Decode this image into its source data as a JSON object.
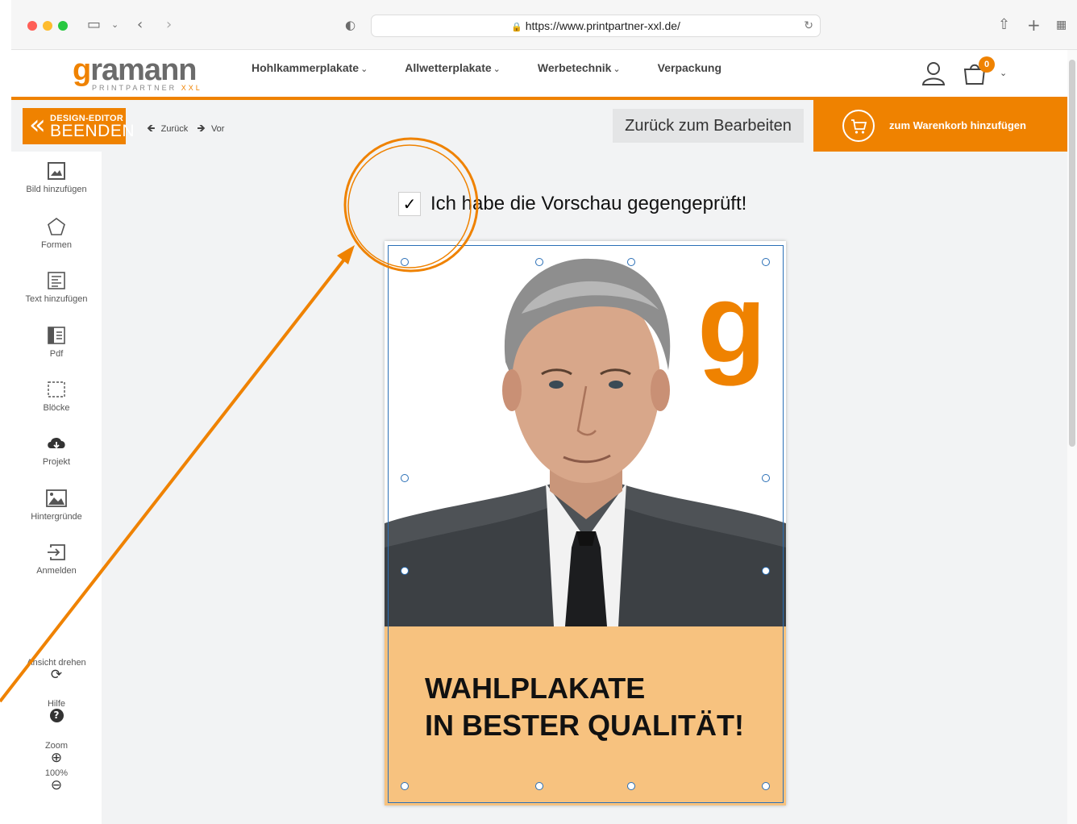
{
  "browser": {
    "url": "https://www.printpartner-xxl.de/"
  },
  "site": {
    "logo_main": "ramann",
    "logo_g": "g",
    "logo_sub": "PRINTPARTNER",
    "logo_xxl": "XXL",
    "nav": [
      {
        "label": "Hohlkammerplakate",
        "chev": "⌄"
      },
      {
        "label": "Allwetterplakate",
        "chev": "⌄"
      },
      {
        "label": "Werbetechnik",
        "chev": "⌄"
      },
      {
        "label": "Verpackung",
        "chev": ""
      }
    ],
    "cart_count": "0"
  },
  "toolbar": {
    "exit_small": "DESIGN-EDITOR",
    "exit_big": "BEENDEN",
    "undo_label": "Zurück",
    "redo_label": "Vor",
    "back_to_edit": "Zurück zum Bearbeiten",
    "add_to_cart": "zum Warenkorb hinzufügen"
  },
  "sidebar": {
    "tools": [
      {
        "label": "Bild hinzufügen",
        "icon": "image-add-icon"
      },
      {
        "label": "Formen",
        "icon": "pentagon-icon"
      },
      {
        "label": "Text hinzufügen",
        "icon": "text-icon"
      },
      {
        "label": "Pdf",
        "icon": "pdf-icon"
      },
      {
        "label": "Blöcke",
        "icon": "blocks-icon"
      },
      {
        "label": "Projekt",
        "icon": "cloud-download-icon"
      },
      {
        "label": "Hintergründe",
        "icon": "background-icon"
      },
      {
        "label": "Anmelden",
        "icon": "login-icon"
      }
    ],
    "rotate_label": "Ansicht drehen",
    "help_label": "Hilfe",
    "zoom_label": "Zoom",
    "zoom_value": "100%"
  },
  "canvas": {
    "checkbox_mark": "✓",
    "confirm_text": "Ich habe die Vorschau gegengeprüft!",
    "poster_line1": "WAHLPLAKATE",
    "poster_line2": "IN BESTER QUALITÄT!",
    "poster_logo": "g"
  },
  "colors": {
    "accent": "#ef8200",
    "poster_band": "#f7c27f",
    "selection": "#2a6fb6"
  }
}
